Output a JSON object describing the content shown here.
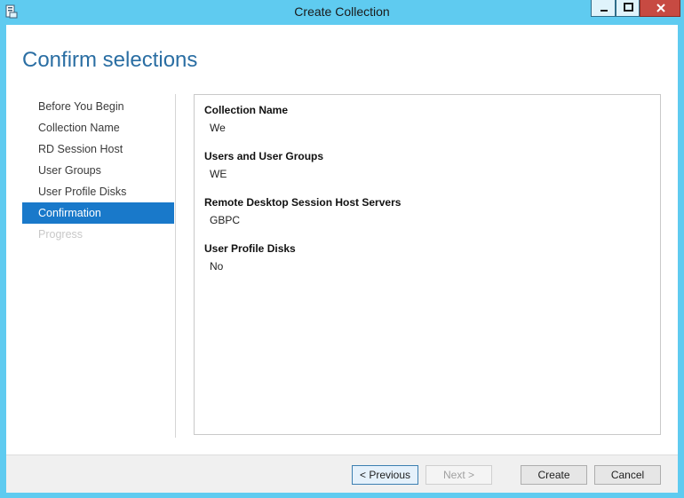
{
  "window": {
    "title": "Create Collection",
    "icons": {
      "app": "server-manager-icon",
      "minimize": "minimize-icon",
      "maximize": "maximize-icon",
      "close": "close-icon"
    }
  },
  "page": {
    "heading": "Confirm selections"
  },
  "sidebar": {
    "items": [
      {
        "label": "Before You Begin",
        "state": "normal"
      },
      {
        "label": "Collection Name",
        "state": "normal"
      },
      {
        "label": "RD Session Host",
        "state": "normal"
      },
      {
        "label": "User Groups",
        "state": "normal"
      },
      {
        "label": "User Profile Disks",
        "state": "normal"
      },
      {
        "label": "Confirmation",
        "state": "active"
      },
      {
        "label": "Progress",
        "state": "disabled"
      }
    ]
  },
  "summary": {
    "fields": [
      {
        "label": "Collection Name",
        "value": "We"
      },
      {
        "label": "Users and User Groups",
        "value": "WE"
      },
      {
        "label": "Remote Desktop Session Host Servers",
        "value": "GBPC"
      },
      {
        "label": "User Profile Disks",
        "value": "No"
      }
    ]
  },
  "footer": {
    "previous": "< Previous",
    "next": "Next >",
    "create": "Create",
    "cancel": "Cancel"
  },
  "colors": {
    "chrome": "#5fcbf0",
    "accent": "#1979ca",
    "heading": "#2a6ea3",
    "close": "#c74a42"
  }
}
